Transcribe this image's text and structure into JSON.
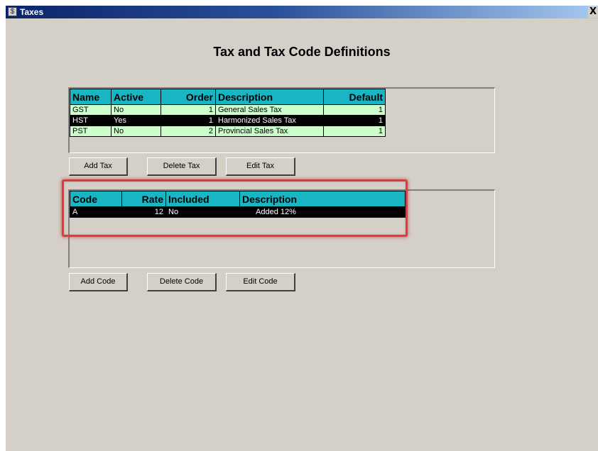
{
  "window": {
    "title": "Taxes",
    "close_label": "X"
  },
  "page": {
    "title": "Tax and Tax Code Definitions"
  },
  "tax_table": {
    "columns": [
      "Name",
      "Active",
      "Order",
      "Description",
      "Default"
    ],
    "rows": [
      {
        "name": "GST",
        "active": "No",
        "order": "1",
        "description": "General Sales Tax",
        "default": "1",
        "selected": false
      },
      {
        "name": "HST",
        "active": "Yes",
        "order": "1",
        "description": "Harmonized Sales Tax",
        "default": "1",
        "selected": true
      },
      {
        "name": "PST",
        "active": "No",
        "order": "2",
        "description": "Provincial Sales Tax",
        "default": "1",
        "selected": false
      }
    ]
  },
  "tax_buttons": {
    "add": "Add Tax",
    "delete": "Delete Tax",
    "edit": "Edit Tax"
  },
  "code_table": {
    "columns": [
      "Code",
      "Rate",
      "Included",
      "Description"
    ],
    "rows": [
      {
        "code": "A",
        "rate": "12",
        "included": "No",
        "description": "Added 12%",
        "selected": true
      }
    ]
  },
  "code_buttons": {
    "add": "Add Code",
    "delete": "Delete Code",
    "edit": "Edit Code"
  },
  "colors": {
    "header_bg": "#1ab5c3",
    "row_bg": "#ccffcc",
    "selected_bg": "#000000",
    "highlight": "#e0393e"
  }
}
